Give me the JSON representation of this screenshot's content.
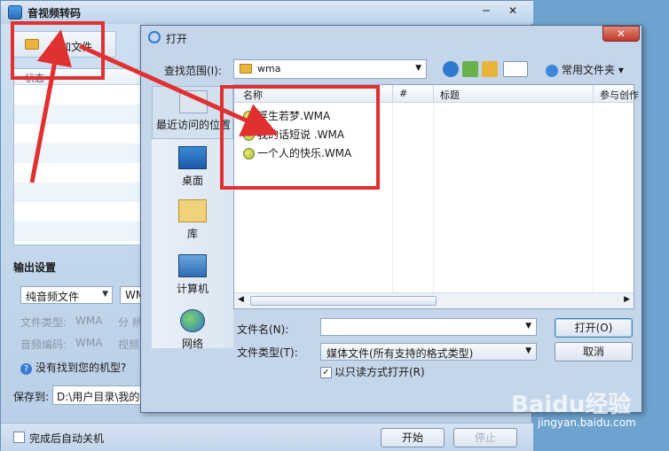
{
  "app": {
    "title": "音视频转码",
    "add_file": "添加文件",
    "list_header": "状态",
    "output_settings": "输出设置",
    "format_value": "纯音频文件",
    "format_value2": "WM",
    "file_type_label": "文件类型:",
    "file_type_value": "WMA",
    "file_type_extra": "分 辨",
    "audio_codec_label": "音频编码:",
    "audio_codec_value": "WMA",
    "audio_codec_extra": "视频",
    "help_link": "没有找到您的机型?",
    "save_to_label": "保存到:",
    "save_to_value": "D:\\用户目录\\我的",
    "auto_shutdown": "完成后自动关机",
    "start": "开始",
    "stop": "停止"
  },
  "dialog": {
    "title": "打开",
    "lookin_label": "查找范围(I):",
    "lookin_value": "wma",
    "favorites": "常用文件夹",
    "places": [
      {
        "label": "最近访问的位置",
        "icon": "recent-places-icon"
      },
      {
        "label": "桌面",
        "icon": "desktop-icon"
      },
      {
        "label": "库",
        "icon": "library-icon"
      },
      {
        "label": "计算机",
        "icon": "computer-icon"
      },
      {
        "label": "网络",
        "icon": "network-icon"
      }
    ],
    "columns": [
      "名称",
      "#",
      "标题",
      "参与创作"
    ],
    "files": [
      "浮生若梦.WMA",
      "我的话短说 .WMA",
      "一个人的快乐.WMA"
    ],
    "filename_label": "文件名(N):",
    "filename_value": "",
    "filetype_label": "文件类型(T):",
    "filetype_value": "媒体文件(所有支持的格式类型)",
    "readonly": "以只读方式打开(R)",
    "open": "打开(O)",
    "cancel": "取消"
  },
  "watermark": {
    "brand": "Baidu经验",
    "url": "jingyan.baidu.com"
  },
  "colors": {
    "annotation": "#e03030"
  }
}
